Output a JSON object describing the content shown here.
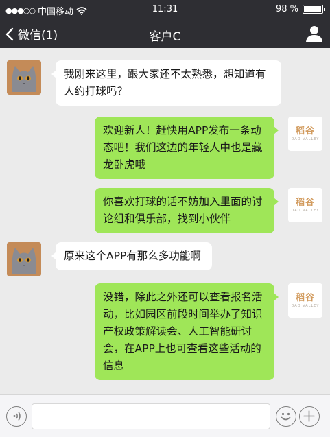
{
  "status_bar": {
    "signal": "●●●○○",
    "carrier": "中国移动",
    "time": "11:31",
    "battery_text": "98 %",
    "battery_level": 0.98
  },
  "nav": {
    "back_label": "微信(1)",
    "title": "客户C"
  },
  "brand_avatar": {
    "mark": "稻谷",
    "sub": "DAO VALLEY"
  },
  "messages": [
    {
      "side": "left",
      "text_lines": [
        "我刚来这里，跟大家还不太熟悉，想知道有",
        "人约打球吗？"
      ]
    },
    {
      "side": "right",
      "text_lines": [
        "欢迎新人！赶快用APP发布一条动",
        "态吧！我们这边的年轻人中也是藏",
        "龙卧虎哦"
      ]
    },
    {
      "side": "right",
      "text_lines": [
        "你喜欢打球的话不妨加入里面的讨",
        "论组和俱乐部，找到小伙伴"
      ]
    },
    {
      "side": "left",
      "text_lines": [
        "原来这个APP有那么多功能啊"
      ]
    },
    {
      "side": "right",
      "text_lines": [
        "没错，除此之外还可以查看报名活",
        "动，比如园区前段时间举办了知识",
        "产权政策解读会、人工智能研讨",
        "会，在APP上也可查看这些活动的",
        "信息"
      ]
    }
  ],
  "input": {
    "value": "",
    "placeholder": ""
  },
  "colors": {
    "bar": "#2e2e33",
    "bubble_right": "#9fe658",
    "bubble_left": "#ffffff",
    "background": "#ebebeb"
  }
}
